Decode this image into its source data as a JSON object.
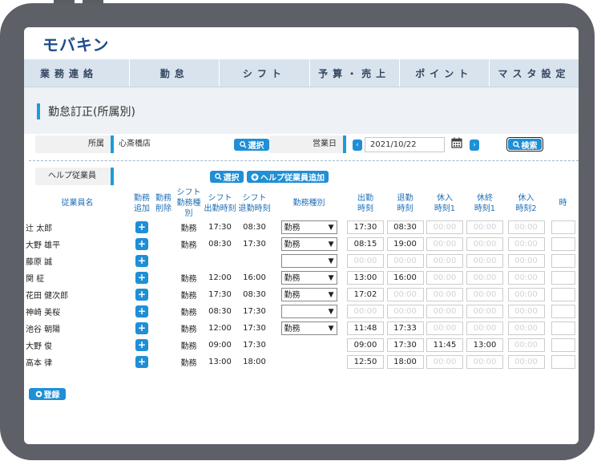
{
  "app": {
    "logo": "モバキン"
  },
  "nav": [
    "業務連絡",
    "勤怠",
    "シフト",
    "予算・売上",
    "ポイント",
    "マスタ設定"
  ],
  "page": {
    "title": "勤怠訂正(所属別)"
  },
  "filters": {
    "store_label": "所属",
    "store_value": "心斎橋店",
    "select_label": "選択",
    "business_day_label": "営業日",
    "date_value": "2021/10/22",
    "search_label": "検索",
    "help_staff_label": "ヘルプ従業員",
    "help_select_label": "選択",
    "help_add_label": "ヘルプ従業員追加"
  },
  "table": {
    "headers": [
      "従業員名",
      "勤務\n追加",
      "勤務\n削除",
      "シフト\n勤務種別",
      "シフト\n出勤時刻",
      "シフト\n退勤時刻",
      "勤務種別",
      "出勤\n時刻",
      "退勤\n時刻",
      "休入\n時刻1",
      "休終\n時刻1",
      "休入\n時刻2",
      "時"
    ],
    "rows": [
      {
        "name": "辻 太郎",
        "shift_type": "勤務",
        "shift_in": "17:30",
        "shift_out": "08:30",
        "work_type": "勤務",
        "clock_in": "17:30",
        "clock_out": "08:30",
        "b1in": "00:00",
        "b1out": "00:00",
        "b2in": "00:00"
      },
      {
        "name": "大野 雄平",
        "shift_type": "勤務",
        "shift_in": "08:30",
        "shift_out": "17:30",
        "work_type": "勤務",
        "clock_in": "08:15",
        "clock_out": "19:00",
        "b1in": "00:00",
        "b1out": "00:00",
        "b2in": "00:00"
      },
      {
        "name": "藤原 誠",
        "shift_type": "",
        "shift_in": "",
        "shift_out": "",
        "work_type": "",
        "clock_in": "00:00",
        "clock_out": "00:00",
        "b1in": "00:00",
        "b1out": "00:00",
        "b2in": "00:00"
      },
      {
        "name": "関 柾",
        "shift_type": "勤務",
        "shift_in": "12:00",
        "shift_out": "16:00",
        "work_type": "勤務",
        "clock_in": "13:00",
        "clock_out": "16:00",
        "b1in": "00:00",
        "b1out": "00:00",
        "b2in": "00:00"
      },
      {
        "name": "花田 健次郎",
        "shift_type": "勤務",
        "shift_in": "17:30",
        "shift_out": "08:30",
        "work_type": "勤務",
        "clock_in": "17:02",
        "clock_out": "00:00",
        "b1in": "00:00",
        "b1out": "00:00",
        "b2in": "00:00"
      },
      {
        "name": "神崎 美桜",
        "shift_type": "勤務",
        "shift_in": "08:30",
        "shift_out": "17:30",
        "work_type": "",
        "clock_in": "00:00",
        "clock_out": "00:00",
        "b1in": "00:00",
        "b1out": "00:00",
        "b2in": "00:00"
      },
      {
        "name": "池谷 朝陽",
        "shift_type": "勤務",
        "shift_in": "12:00",
        "shift_out": "17:30",
        "work_type": "勤務",
        "clock_in": "11:48",
        "clock_out": "17:33",
        "b1in": "00:00",
        "b1out": "00:00",
        "b2in": "00:00"
      },
      {
        "name": "大野 俊",
        "shift_type": "勤務",
        "shift_in": "09:00",
        "shift_out": "17:30",
        "work_type": null,
        "clock_in": "09:00",
        "clock_out": "17:30",
        "b1in": "11:45",
        "b1out": "13:00",
        "b2in": "00:00"
      },
      {
        "name": "高本 律",
        "shift_type": "勤務",
        "shift_in": "13:00",
        "shift_out": "18:00",
        "work_type": null,
        "clock_in": "12:50",
        "clock_out": "18:00",
        "b1in": "00:00",
        "b1out": "00:00",
        "b2in": "00:00"
      }
    ]
  },
  "register_label": "登録",
  "colors": {
    "accent": "#1f8fd6",
    "nav_bg": "#d8e3ee",
    "title_bg": "#eef2f6",
    "device_frame": "#5d6066"
  },
  "icons": {
    "search": "search-icon",
    "calendar": "calendar-icon",
    "prev": "chevron-left-icon",
    "next": "chevron-right-icon",
    "add": "plus-icon",
    "dropdown": "chevron-down-icon"
  }
}
